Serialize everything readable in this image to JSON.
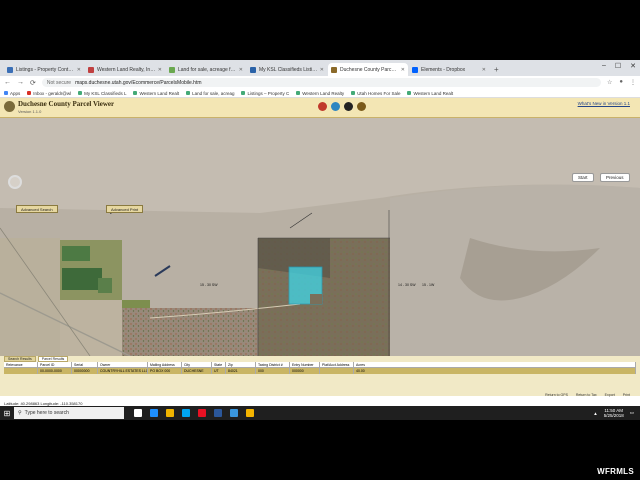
{
  "browser": {
    "tabs": [
      {
        "label": "Listings - Property Control Cent",
        "color": "#3b6fb6"
      },
      {
        "label": "Western Land Realty, Inc. Admin",
        "color": "#c04040"
      },
      {
        "label": "Land for sale, acreage for sale",
        "color": "#6aa84f"
      },
      {
        "label": "My KSL Classifieds Listings | ksl",
        "color": "#2a62a8"
      },
      {
        "label": "Duchesne County Parcel Viewer",
        "color": "#8b6a2a",
        "active": true
      },
      {
        "label": "Elements - Dropbox",
        "color": "#0061fe"
      }
    ],
    "new_tab": "+",
    "window_controls": [
      "–",
      "☐",
      "✕"
    ],
    "nav": {
      "back": "←",
      "forward": "→",
      "reload": "⟳"
    },
    "address": {
      "secure": "Not secure",
      "url": "maps.duchesne.utah.gov/Ecommerce/ParcelsMobile.htm"
    },
    "bookmarks": [
      "Apps",
      "Inbox - geraldr@wl",
      "My KSL Classifieds L",
      "Western Land Realt",
      "Land for sale, acreag",
      "Listings – Property C",
      "Western Land Realty",
      "Utah Homes For Sale",
      "Western Land Realt"
    ]
  },
  "app": {
    "title": "Duchesne County Parcel Viewer",
    "version": "Version 1.1.0",
    "whats_new": "What's New in Version 1.1",
    "tool_colors": [
      "#c0392b",
      "#2e86c1",
      "#222222",
      "#7a5a1a"
    ],
    "buttons": {
      "select": "Select",
      "print": "Print",
      "advanced_search": "Advanced Search",
      "advanced_print": "Advanced Print",
      "start": "Start",
      "previous": "Previous"
    }
  },
  "map": {
    "labels": [
      "15 - 30 SW",
      "14 - 30 SW",
      "15 - 1W"
    ]
  },
  "results": {
    "tabs": [
      "Search Results",
      "Parcel Results"
    ],
    "columns": [
      "Relevance",
      "Parcel ID",
      "Serial",
      "Owner",
      "Mailing Address",
      "City",
      "State",
      "Zip",
      "Taxing District #",
      "Entry Number",
      "Plat/Acct Address",
      "Acres"
    ],
    "row": [
      "",
      "00-0000-0000",
      "00000000",
      "COUNTRYHILL ESTATES LLC",
      "PO BOX 000",
      "DUCHESNE",
      "UT",
      "84021",
      "000",
      "000000",
      "",
      "40.00"
    ],
    "status": "Latitude: 40.298863   Longitude: -110.358170",
    "extra": [
      "Return to GPS",
      "Return to Tax",
      "Export",
      "Print"
    ]
  },
  "taskbar": {
    "search": "Type here to search",
    "time": "11:50 AM",
    "date": "5/25/2018",
    "app_colors": [
      "#ffffff",
      "#1e90ff",
      "#f0b400",
      "#00a4ef",
      "#e81123",
      "#2b579a",
      "#3a96dd",
      "#f4b400"
    ]
  },
  "watermark": "WFRMLS"
}
